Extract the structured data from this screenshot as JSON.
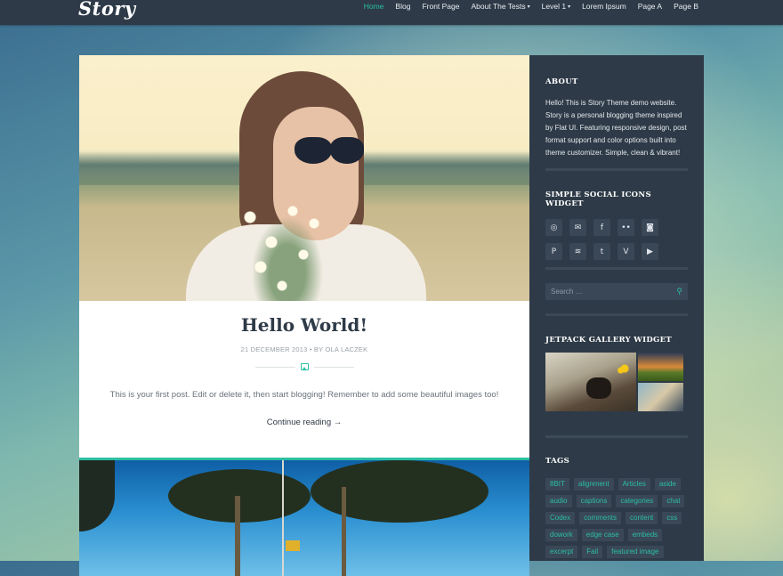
{
  "site": {
    "logo": "Story"
  },
  "nav": {
    "items": [
      {
        "label": "Home",
        "active": true,
        "dropdown": false
      },
      {
        "label": "Blog",
        "active": false,
        "dropdown": false
      },
      {
        "label": "Front Page",
        "active": false,
        "dropdown": false
      },
      {
        "label": "About The Tests",
        "active": false,
        "dropdown": true
      },
      {
        "label": "Level 1",
        "active": false,
        "dropdown": true
      },
      {
        "label": "Lorem Ipsum",
        "active": false,
        "dropdown": false
      },
      {
        "label": "Page A",
        "active": false,
        "dropdown": false
      },
      {
        "label": "Page B",
        "active": false,
        "dropdown": false
      }
    ],
    "caret": "▾"
  },
  "post": {
    "title": "Hello World!",
    "meta": "21 DECEMBER 2013 • BY OLA LACZEK",
    "format_icon": "image-icon",
    "excerpt": "This is your first post. Edit or delete it, then start blogging! Remember to add some beautiful images too!",
    "continue": "Continue reading →"
  },
  "sidebar": {
    "about": {
      "title": "ABOUT",
      "text": "Hello! This is Story Theme demo website. Story is a personal blogging theme inspired by Flat UI. Featuring responsive design, post format support and color options built into theme customizer. Simple, clean & vibrant!"
    },
    "social": {
      "title": "SIMPLE SOCIAL ICONS WIDGET",
      "icons": [
        {
          "name": "dribbble-icon",
          "glyph": "◎"
        },
        {
          "name": "email-icon",
          "glyph": "✉"
        },
        {
          "name": "facebook-icon",
          "glyph": "f"
        },
        {
          "name": "flickr-icon",
          "glyph": "••"
        },
        {
          "name": "instagram-icon",
          "glyph": "◙"
        },
        {
          "name": "pinterest-icon",
          "glyph": "P"
        },
        {
          "name": "rss-icon",
          "glyph": "≋"
        },
        {
          "name": "twitter-icon",
          "glyph": "t"
        },
        {
          "name": "vimeo-icon",
          "glyph": "V"
        },
        {
          "name": "youtube-icon",
          "glyph": "▶"
        }
      ]
    },
    "search": {
      "placeholder": "Search …",
      "button_glyph": "⚲"
    },
    "gallery": {
      "title": "JETPACK GALLERY WIDGET"
    },
    "tags": {
      "title": "TAGS",
      "items": [
        "8BIT",
        "alignment",
        "Articles",
        "aside",
        "audio",
        "captions",
        "categories",
        "chat",
        "Codex",
        "comments",
        "content",
        "css",
        "dowork",
        "edge case",
        "embeds",
        "excerpt",
        "Fail",
        "featured image"
      ]
    }
  },
  "colors": {
    "accent": "#2bbfa3",
    "dark": "#2e3a47"
  }
}
